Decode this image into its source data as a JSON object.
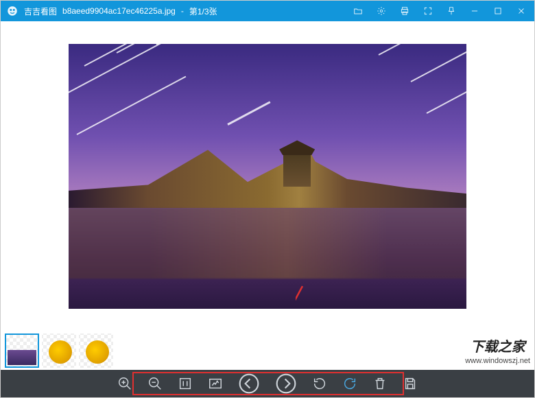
{
  "titlebar": {
    "app_name": "吉吉看图",
    "filename": "b8aeed9904ac17ec46225a.jpg",
    "separator": " - ",
    "position": "第1/3张"
  },
  "thumbnails": {
    "items": [
      {
        "kind": "landscape",
        "selected": true
      },
      {
        "kind": "pika",
        "selected": false
      },
      {
        "kind": "pika",
        "selected": false
      }
    ]
  },
  "toolbar": {
    "zoom_in": "zoom-in",
    "zoom_out": "zoom-out",
    "actual_size": "actual-size",
    "fit_screen": "fit-screen",
    "prev": "previous-image",
    "next": "next-image",
    "rotate_left": "rotate-left",
    "rotate_right": "rotate-right",
    "delete": "delete",
    "save": "save"
  },
  "watermark": {
    "cn": "下载之家",
    "url": "www.windowszj.net"
  },
  "annotation": {
    "arrow_label": "highlight-arrow",
    "box_label": "toolbar-highlight"
  }
}
